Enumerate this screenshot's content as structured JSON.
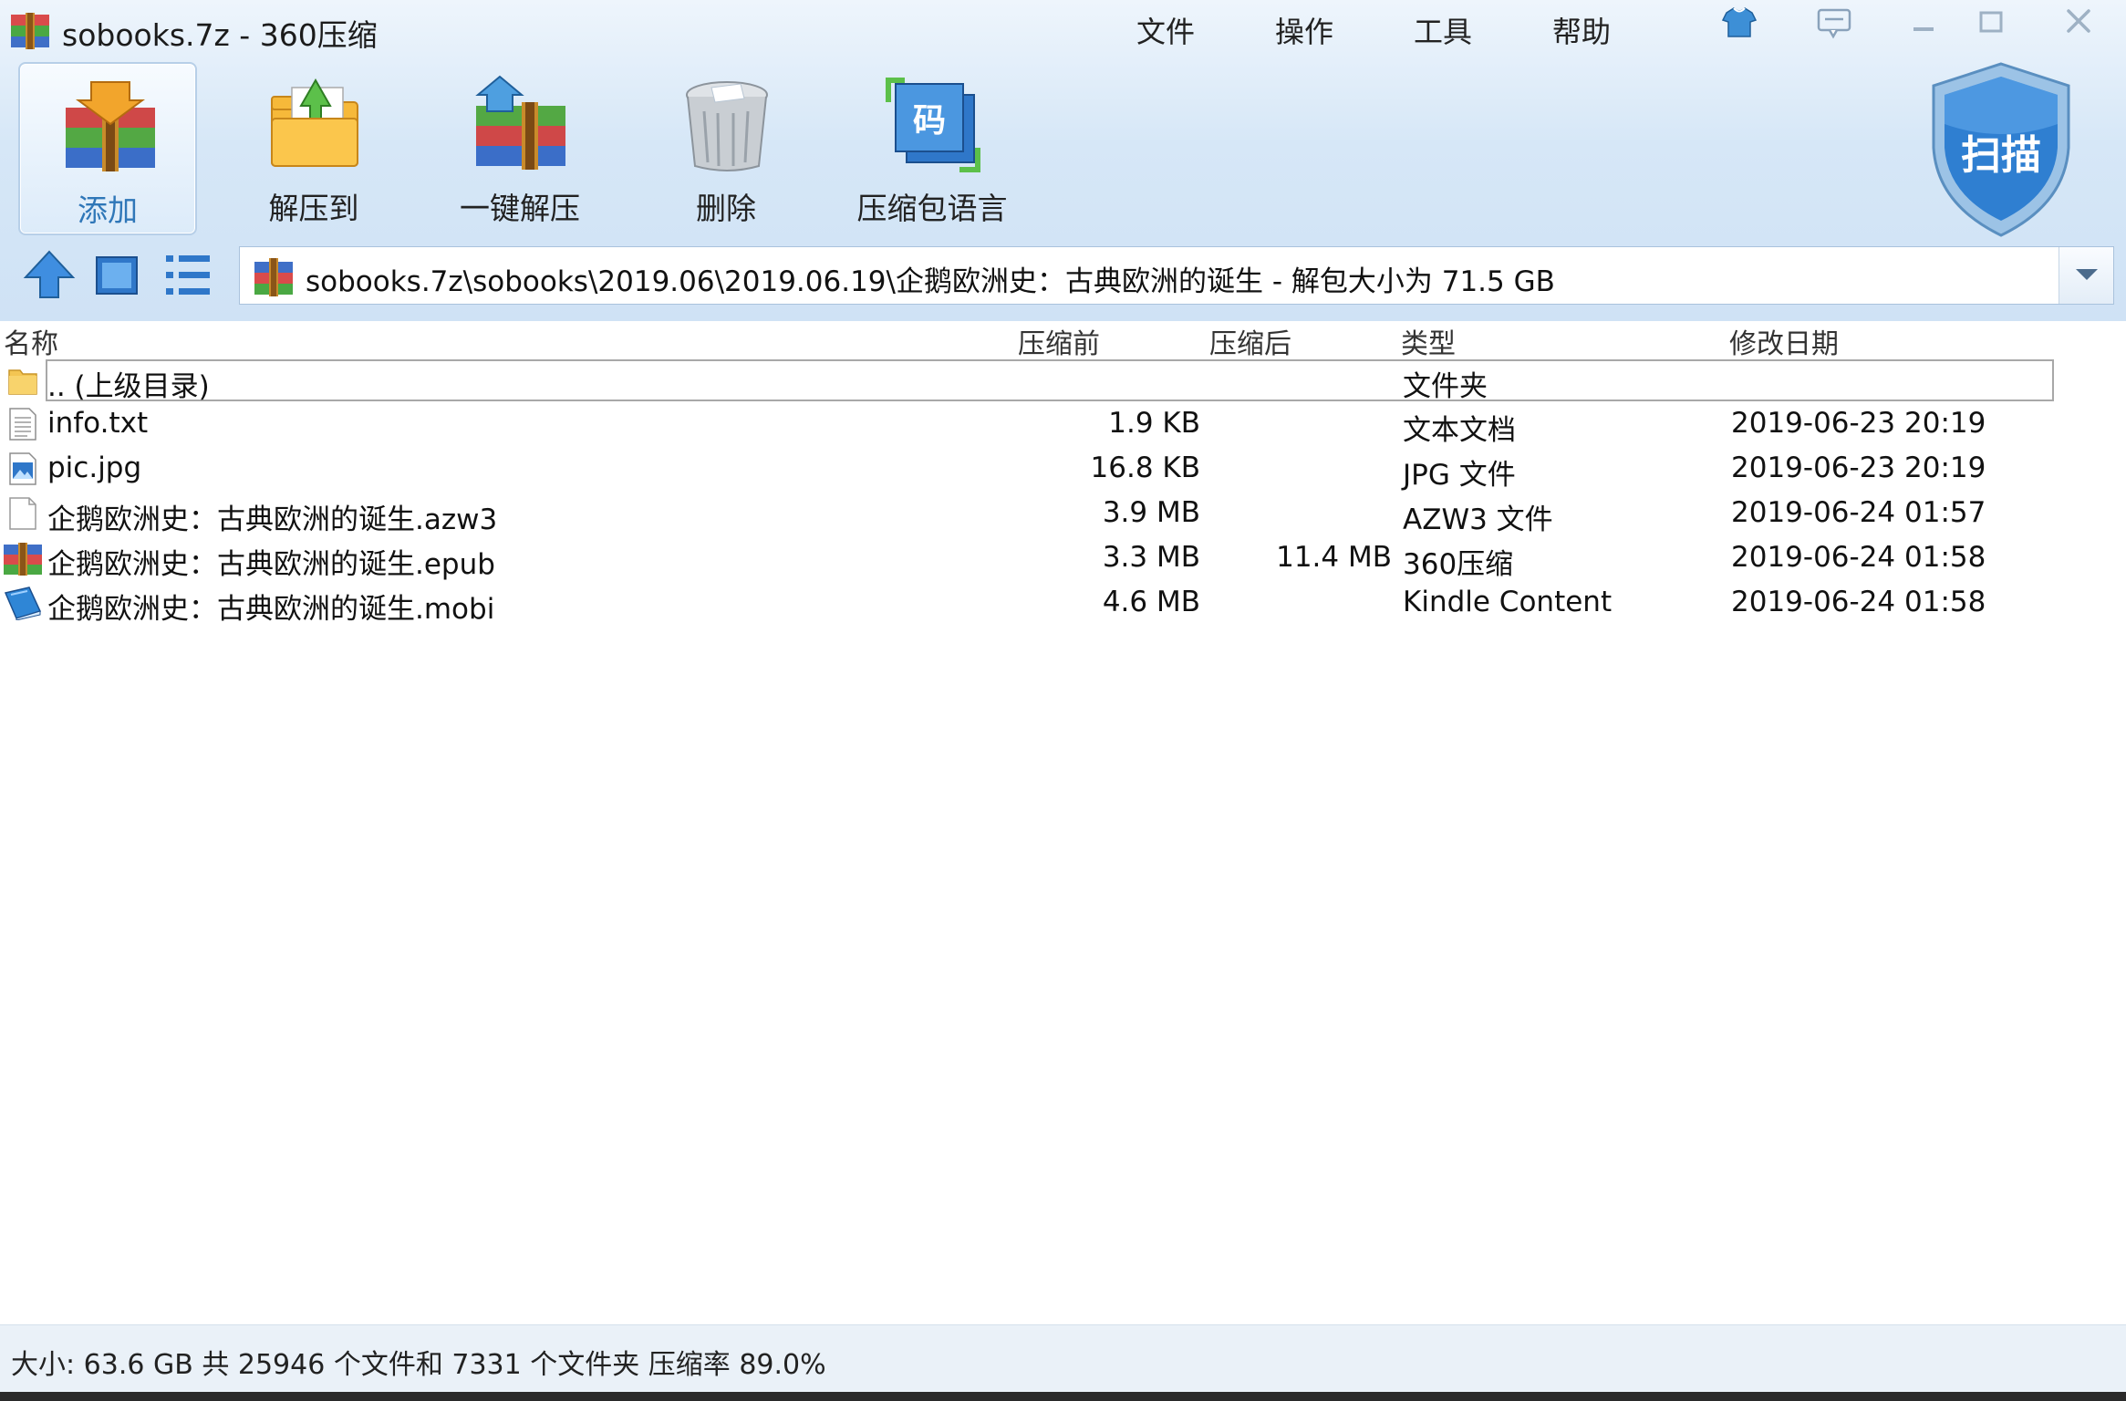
{
  "window": {
    "title": "sobooks.7z - 360压缩",
    "menu": [
      "文件",
      "操作",
      "工具",
      "帮助"
    ]
  },
  "toolbar": {
    "add_label": "添加",
    "extract_to_label": "解压到",
    "one_click_extract_label": "一键解压",
    "delete_label": "删除",
    "encoding_label": "压缩包语言"
  },
  "scan": {
    "label": "扫描"
  },
  "address": {
    "path": "sobooks.7z\\sobooks\\2019.06\\2019.06.19\\企鹅欧洲史：古典欧洲的诞生 - 解包大小为 71.5 GB"
  },
  "columns": {
    "name": "名称",
    "original_size": "压缩前",
    "compressed_size": "压缩后",
    "type": "类型",
    "modified": "修改日期"
  },
  "files": [
    {
      "name": ".. (上级目录)",
      "original_size": "",
      "compressed_size": "",
      "type": "文件夹",
      "modified": "",
      "icon": "folder-icon"
    },
    {
      "name": "info.txt",
      "original_size": "1.9 KB",
      "compressed_size": "",
      "type": "文本文档",
      "modified": "2019-06-23 20:19",
      "icon": "text-file-icon"
    },
    {
      "name": "pic.jpg",
      "original_size": "16.8 KB",
      "compressed_size": "",
      "type": "JPG 文件",
      "modified": "2019-06-23 20:19",
      "icon": "image-file-icon"
    },
    {
      "name": "企鹅欧洲史：古典欧洲的诞生.azw3",
      "original_size": "3.9 MB",
      "compressed_size": "",
      "type": "AZW3 文件",
      "modified": "2019-06-24 01:57",
      "icon": "blank-file-icon"
    },
    {
      "name": "企鹅欧洲史：古典欧洲的诞生.epub",
      "original_size": "3.3 MB",
      "compressed_size": "11.4 MB",
      "type": "360压缩",
      "modified": "2019-06-24 01:58",
      "icon": "archive-file-icon"
    },
    {
      "name": "企鹅欧洲史：古典欧洲的诞生.mobi",
      "original_size": "4.6 MB",
      "compressed_size": "",
      "type": "Kindle Content",
      "modified": "2019-06-24 01:58",
      "icon": "kindle-book-icon"
    }
  ],
  "status": {
    "summary": "大小: 63.6 GB 共 25946 个文件和 7331 个文件夹 压缩率 89.0%"
  },
  "colors": {
    "chrome_top": "#eef5fc",
    "chrome_bottom": "#cfe2f5",
    "accent_blue": "#2f77b8",
    "status_bg": "#eaf1f8"
  }
}
